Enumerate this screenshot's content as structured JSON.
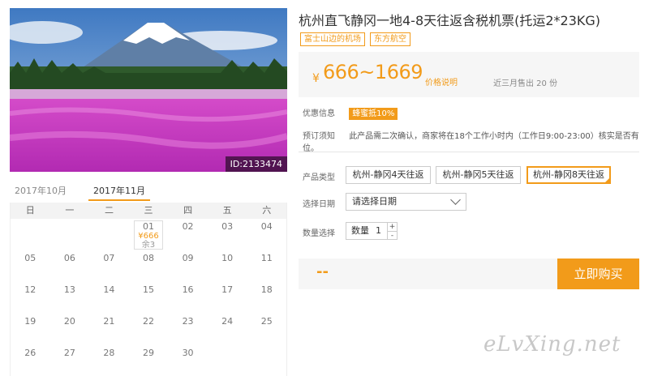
{
  "photo": {
    "id_label": "ID:2133474"
  },
  "calendar": {
    "tabs": [
      "2017年10月",
      "2017年11月"
    ],
    "active_tab": 1,
    "weekdays": [
      "日",
      "一",
      "二",
      "三",
      "四",
      "五",
      "六"
    ],
    "days": [
      {
        "d": "",
        "price": "",
        "left": ""
      },
      {
        "d": "",
        "price": "",
        "left": ""
      },
      {
        "d": "",
        "price": "",
        "left": ""
      },
      {
        "d": "01",
        "price": "¥666",
        "left": "余3"
      },
      {
        "d": "02",
        "price": "",
        "left": ""
      },
      {
        "d": "03",
        "price": "",
        "left": ""
      },
      {
        "d": "04",
        "price": "",
        "left": ""
      },
      {
        "d": "05",
        "price": "",
        "left": ""
      },
      {
        "d": "06",
        "price": "",
        "left": ""
      },
      {
        "d": "07",
        "price": "",
        "left": ""
      },
      {
        "d": "08",
        "price": "",
        "left": ""
      },
      {
        "d": "09",
        "price": "",
        "left": ""
      },
      {
        "d": "10",
        "price": "",
        "left": ""
      },
      {
        "d": "11",
        "price": "",
        "left": ""
      },
      {
        "d": "12",
        "price": "",
        "left": ""
      },
      {
        "d": "13",
        "price": "",
        "left": ""
      },
      {
        "d": "14",
        "price": "",
        "left": ""
      },
      {
        "d": "15",
        "price": "",
        "left": ""
      },
      {
        "d": "16",
        "price": "",
        "left": ""
      },
      {
        "d": "17",
        "price": "",
        "left": ""
      },
      {
        "d": "18",
        "price": "",
        "left": ""
      },
      {
        "d": "19",
        "price": "",
        "left": ""
      },
      {
        "d": "20",
        "price": "",
        "left": ""
      },
      {
        "d": "21",
        "price": "",
        "left": ""
      },
      {
        "d": "22",
        "price": "",
        "left": ""
      },
      {
        "d": "23",
        "price": "",
        "left": ""
      },
      {
        "d": "24",
        "price": "",
        "left": ""
      },
      {
        "d": "25",
        "price": "",
        "left": ""
      },
      {
        "d": "26",
        "price": "",
        "left": ""
      },
      {
        "d": "27",
        "price": "",
        "left": ""
      },
      {
        "d": "28",
        "price": "",
        "left": ""
      },
      {
        "d": "29",
        "price": "",
        "left": ""
      },
      {
        "d": "30",
        "price": "",
        "left": ""
      }
    ]
  },
  "product": {
    "title": "杭州直飞静冈一地4-8天往返含税机票(托运2*23KG)",
    "tags": [
      "富士山边的机场",
      "东方航空"
    ],
    "price_currency": "¥",
    "price_range": "666~1669",
    "price_note": "价格说明",
    "sold_text": "近三月售出 20 份",
    "promo_label": "优惠信息",
    "promo_badge": "蜂蜜抵10%",
    "booking_label": "预订须知",
    "booking_text": "此产品需二次确认，商家将在18个工作小时内（工作日9:00-23:00）核实是否有位。"
  },
  "options": {
    "type_label": "产品类型",
    "types": [
      "杭州-静冈4天往返",
      "杭州-静冈5天往返",
      "杭州-静冈8天往返"
    ],
    "selected_type": 2,
    "date_label": "选择日期",
    "date_placeholder": "请选择日期",
    "qty_label": "数量选择",
    "qty_prefix": "数量",
    "qty_value": "1",
    "qty_plus": "+",
    "qty_minus": "-"
  },
  "buy": {
    "total": "--",
    "button_label": "立即购买"
  },
  "watermark": "eLvXing.net",
  "colors": {
    "accent": "#f29b1a"
  }
}
